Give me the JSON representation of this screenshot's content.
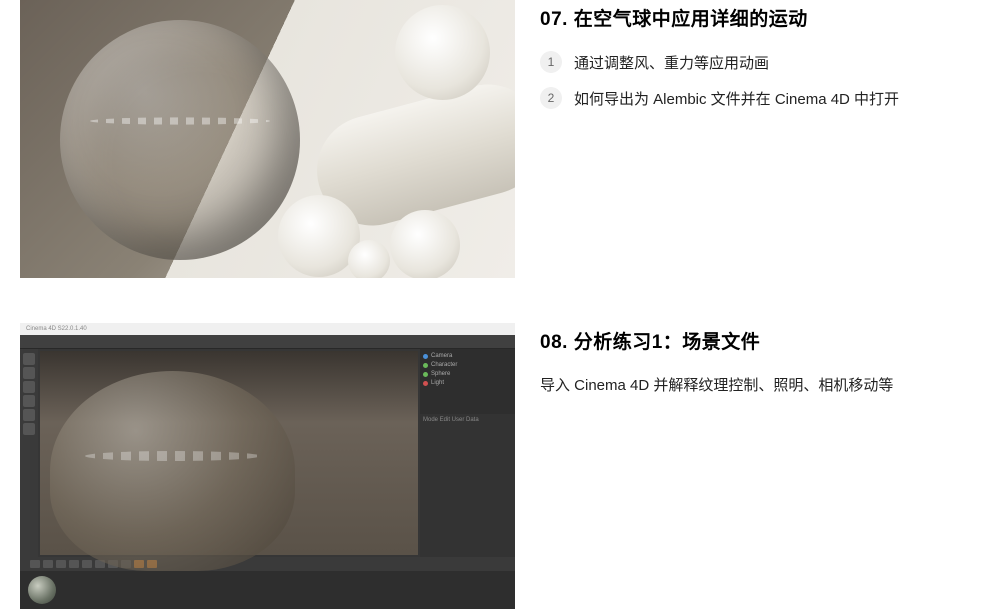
{
  "sections": [
    {
      "title": "07. 在空气球中应用详细的运动",
      "items": [
        {
          "num": "1",
          "text": "通过调整风、重力等应用动画"
        },
        {
          "num": "2",
          "text": "如何导出为 Alembic 文件并在 Cinema 4D 中打开"
        }
      ]
    },
    {
      "title": "08. 分析练习1：场景文件",
      "description": "导入 Cinema 4D 并解释纹理控制、照明、相机移动等"
    }
  ],
  "c4d_ui": {
    "titlebar": "Cinema 4D S22.0.1.40",
    "attr_tab": "Mode  Edit  User Data",
    "objects": [
      "Camera",
      "Character",
      "Sphere",
      "Light"
    ]
  }
}
